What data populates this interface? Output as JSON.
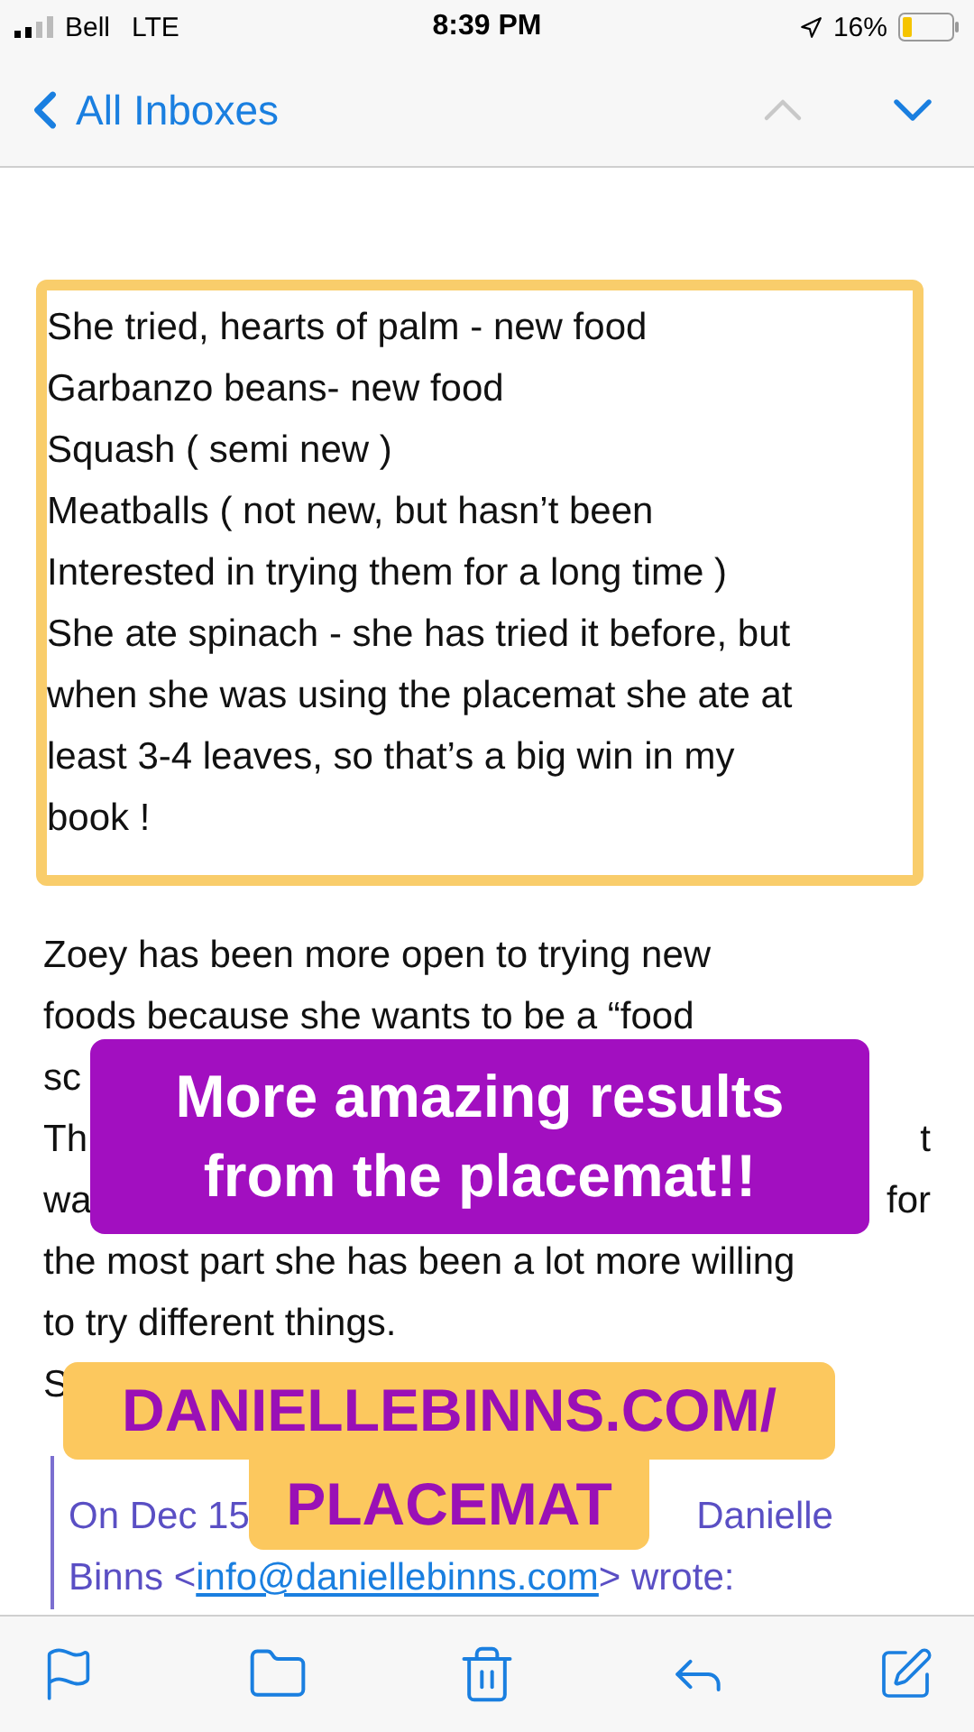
{
  "status_bar": {
    "carrier": "Bell",
    "network": "LTE",
    "time": "8:39 PM",
    "battery": "16%"
  },
  "nav": {
    "back": "All Inboxes",
    "arrows": [
      {
        "kind": "up",
        "disabled": true
      },
      {
        "kind": "down",
        "disabled": false
      }
    ]
  },
  "highlighted_lines": [
    "She tried, hearts of palm - new food",
    "Garbanzo beans- new food",
    "Squash ( semi new )",
    "Meatballs ( not new, but hasn’t been",
    "Interested in trying them for a long time )",
    "She ate spinach - she has tried it before, but",
    "when she was using the placemat she ate at",
    "least 3-4 leaves, so that’s a big win in my",
    "book !"
  ],
  "body_lines": [
    {
      "left": "Zoey has been more open to trying new"
    },
    {
      "left": "foods because she wants to be a “food"
    },
    {
      "left": "sc"
    },
    {
      "left": "Th",
      "right": "t"
    },
    {
      "left": "wa",
      "right": "for"
    },
    {
      "left": "the most part she has been a lot more willing"
    },
    {
      "left": "to try different things."
    },
    {
      "left": "S"
    }
  ],
  "quote": {
    "header_left": "On Dec 15",
    "header_right": "Danielle",
    "before": "Binns <",
    "email": "info@daniellebinns.com",
    "after": "> wrote:"
  },
  "stickers": {
    "headline": "More amazing results from the placemat!!",
    "link_lines": [
      "DANIELLEBINNS.COM/",
      "PLACEMAT"
    ]
  }
}
